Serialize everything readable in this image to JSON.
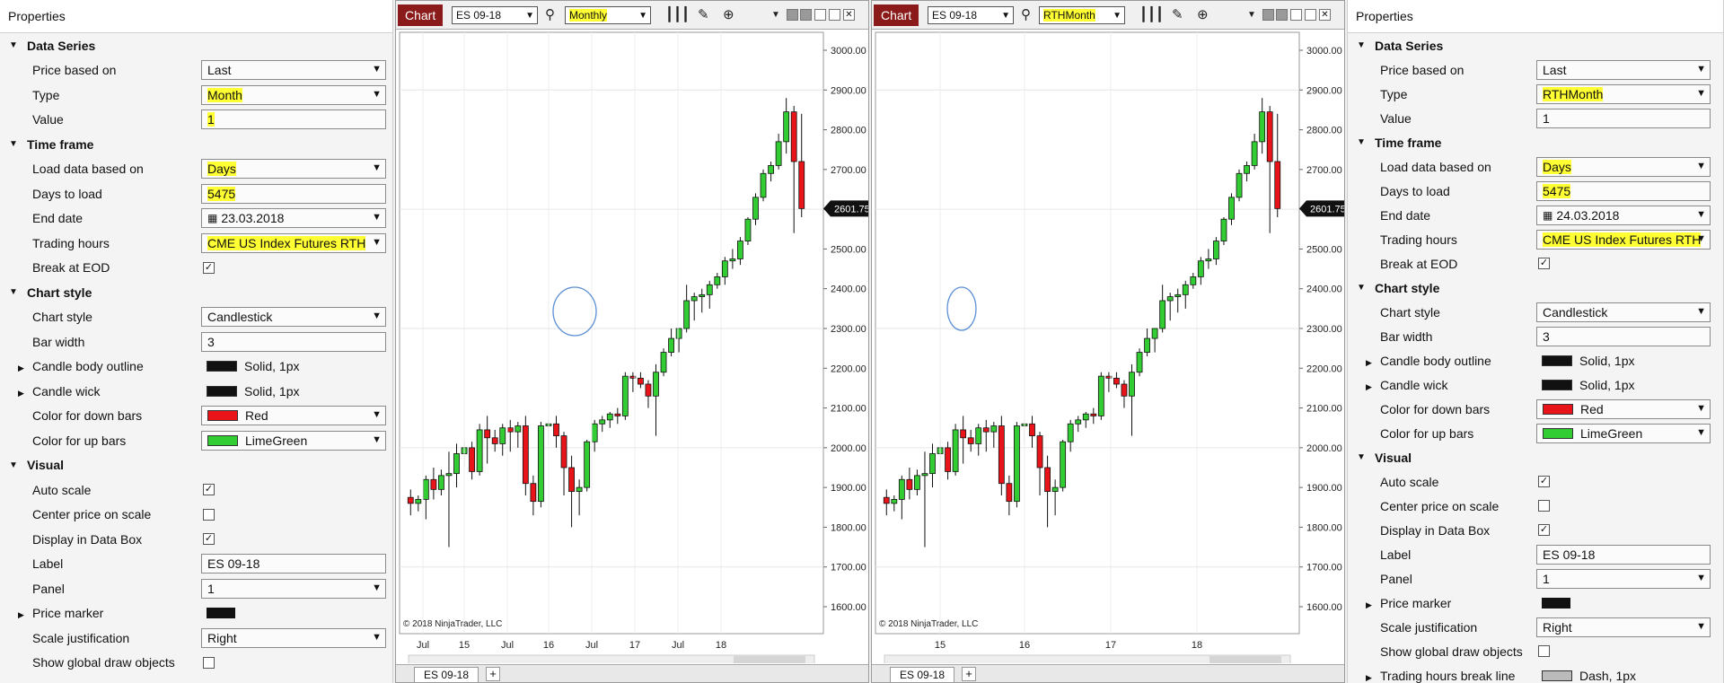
{
  "left_props": {
    "title": "Properties",
    "sections": [
      {
        "name": "Data Series",
        "rows": [
          {
            "label": "Price based on",
            "type": "select",
            "value": "Last"
          },
          {
            "label": "Type",
            "type": "select",
            "value": "Month",
            "hl": true
          },
          {
            "label": "Value",
            "type": "text",
            "value": "1",
            "hl": true
          },
          {
            "label": "",
            "gap": true
          }
        ]
      },
      {
        "name": "Time frame",
        "rows": [
          {
            "label": "Load data based on",
            "type": "select",
            "value": "Days",
            "hl": true
          },
          {
            "label": "Days to load",
            "type": "text",
            "value": "5475",
            "hl": true
          },
          {
            "label": "End date",
            "type": "date",
            "value": "23.03.2018"
          },
          {
            "label": "Trading hours",
            "type": "select",
            "value": "CME US Index Futures RTH",
            "hl": true
          },
          {
            "label": "Break at EOD",
            "type": "check",
            "checked": true
          }
        ]
      },
      {
        "name": "Chart style",
        "rows": [
          {
            "label": "Chart style",
            "type": "select",
            "value": "Candlestick"
          },
          {
            "label": "Bar width",
            "type": "text",
            "value": "3"
          },
          {
            "label": "Candle body outline",
            "type": "stroke",
            "value": "Solid, 1px",
            "expand": true
          },
          {
            "label": "Candle wick",
            "type": "stroke",
            "value": "Solid, 1px",
            "expand": true
          },
          {
            "label": "Color for down bars",
            "type": "color",
            "value": "Red",
            "color": "#e8141a"
          },
          {
            "label": "Color for up bars",
            "type": "color",
            "value": "LimeGreen",
            "color": "#32cd32"
          }
        ]
      },
      {
        "name": "Visual",
        "rows": [
          {
            "label": "Auto scale",
            "type": "check",
            "checked": true
          },
          {
            "label": "Center price on scale",
            "type": "check",
            "checked": false
          },
          {
            "label": "Display in Data Box",
            "type": "check",
            "checked": true
          },
          {
            "label": "Label",
            "type": "text",
            "value": "ES 09-18"
          },
          {
            "label": "Panel",
            "type": "select",
            "value": "1"
          },
          {
            "label": "Price marker",
            "type": "marker",
            "expand": true
          },
          {
            "label": "Scale justification",
            "type": "select",
            "value": "Right"
          },
          {
            "label": "Show global draw objects",
            "type": "check",
            "checked": false
          }
        ]
      }
    ]
  },
  "right_props": {
    "title": "Properties",
    "sections": [
      {
        "name": "Data Series",
        "rows": [
          {
            "label": "Price based on",
            "type": "select",
            "value": "Last"
          },
          {
            "label": "Type",
            "type": "select",
            "value": "RTHMonth",
            "hl": true
          },
          {
            "label": "Value",
            "type": "text",
            "value": "1"
          }
        ]
      },
      {
        "name": "Time frame",
        "rows": [
          {
            "label": "Load data based on",
            "type": "select",
            "value": "Days",
            "hl": true
          },
          {
            "label": "Days to load",
            "type": "text",
            "value": "5475",
            "hl": true
          },
          {
            "label": "End date",
            "type": "date",
            "value": "24.03.2018"
          },
          {
            "label": "Trading hours",
            "type": "select",
            "value": "CME US Index Futures RTH",
            "hl": true
          },
          {
            "label": "Break at EOD",
            "type": "check",
            "checked": true
          }
        ]
      },
      {
        "name": "Chart style",
        "rows": [
          {
            "label": "Chart style",
            "type": "select",
            "value": "Candlestick"
          },
          {
            "label": "Bar width",
            "type": "text",
            "value": "3"
          },
          {
            "label": "Candle body outline",
            "type": "stroke",
            "value": "Solid, 1px",
            "expand": true
          },
          {
            "label": "Candle wick",
            "type": "stroke",
            "value": "Solid, 1px",
            "expand": true
          },
          {
            "label": "Color for down bars",
            "type": "color",
            "value": "Red",
            "color": "#e8141a"
          },
          {
            "label": "Color for up bars",
            "type": "color",
            "value": "LimeGreen",
            "color": "#32cd32"
          }
        ]
      },
      {
        "name": "Visual",
        "rows": [
          {
            "label": "Auto scale",
            "type": "check",
            "checked": true
          },
          {
            "label": "Center price on scale",
            "type": "check",
            "checked": false
          },
          {
            "label": "Display in Data Box",
            "type": "check",
            "checked": true
          },
          {
            "label": "Label",
            "type": "text",
            "value": "ES 09-18"
          },
          {
            "label": "Panel",
            "type": "select",
            "value": "1"
          },
          {
            "label": "Price marker",
            "type": "marker",
            "expand": true
          },
          {
            "label": "Scale justification",
            "type": "select",
            "value": "Right"
          },
          {
            "label": "Show global draw objects",
            "type": "check",
            "checked": false
          },
          {
            "label": "Trading hours break line",
            "type": "stroke2",
            "value": "Dash, 1px",
            "expand": true
          }
        ]
      }
    ]
  },
  "left_chart": {
    "button": "Chart",
    "instrument": "ES 09-18",
    "period": "Monthly",
    "copyright": "© 2018 NinjaTrader, LLC",
    "tab": "ES 09-18",
    "plus": "+",
    "price_label": "2601.75",
    "chart_data": {
      "type": "candlestick",
      "y_ticks": [
        "3000.00",
        "2900.00",
        "2800.00",
        "2700.00",
        "2600.00",
        "2500.00",
        "2400.00",
        "2300.00",
        "2200.00",
        "2100.00",
        "2000.00",
        "1900.00",
        "1800.00",
        "1700.00",
        "1600.00"
      ],
      "ylim": [
        1600,
        3000
      ],
      "x_ticks": [
        "Jul",
        "15",
        "Jul",
        "16",
        "Jul",
        "17",
        "Jul",
        "18"
      ],
      "last": 2601.75
    }
  },
  "right_chart": {
    "button": "Chart",
    "instrument": "ES 09-18",
    "period": "RTHMonth",
    "copyright": "© 2018 NinjaTrader, LLC",
    "tab": "ES 09-18",
    "plus": "+",
    "price_label": "2601.75",
    "chart_data": {
      "type": "candlestick",
      "y_ticks": [
        "3000.00",
        "2900.00",
        "2800.00",
        "2700.00",
        "2600.00",
        "2500.00",
        "2400.00",
        "2300.00",
        "2200.00",
        "2100.00",
        "2000.00",
        "1900.00",
        "1800.00",
        "1700.00",
        "1600.00"
      ],
      "ylim": [
        1600,
        3000
      ],
      "x_ticks": [
        "15",
        "16",
        "17",
        "18"
      ],
      "last": 2601.75
    }
  },
  "candles": [
    [
      1875,
      1895,
      1830,
      1860
    ],
    [
      1860,
      1880,
      1840,
      1870
    ],
    [
      1870,
      1930,
      1820,
      1920
    ],
    [
      1920,
      1950,
      1870,
      1895
    ],
    [
      1895,
      1945,
      1880,
      1930
    ],
    [
      1930,
      1990,
      1750,
      1935
    ],
    [
      1935,
      2010,
      1900,
      1985
    ],
    [
      1985,
      2020,
      1950,
      2000
    ],
    [
      2000,
      2015,
      1920,
      1940
    ],
    [
      1940,
      2060,
      1930,
      2045
    ],
    [
      2045,
      2080,
      1960,
      2025
    ],
    [
      2025,
      2045,
      1990,
      2010
    ],
    [
      2010,
      2060,
      1980,
      2050
    ],
    [
      2050,
      2070,
      1990,
      2040
    ],
    [
      2040,
      2065,
      2000,
      2055
    ],
    [
      2055,
      2080,
      1880,
      1910
    ],
    [
      1910,
      1930,
      1830,
      1865
    ],
    [
      1865,
      2065,
      1850,
      2055
    ],
    [
      2055,
      2070,
      2010,
      2060
    ],
    [
      2060,
      2080,
      2000,
      2030
    ],
    [
      2030,
      2040,
      1880,
      1950
    ],
    [
      1950,
      1980,
      1800,
      1890
    ],
    [
      1890,
      1920,
      1830,
      1900
    ],
    [
      1900,
      2020,
      1890,
      2015
    ],
    [
      2015,
      2070,
      1990,
      2060
    ],
    [
      2060,
      2080,
      2040,
      2070
    ],
    [
      2070,
      2090,
      2050,
      2085
    ],
    [
      2085,
      2100,
      2060,
      2080
    ],
    [
      2080,
      2190,
      2070,
      2180
    ],
    [
      2180,
      2190,
      2140,
      2175
    ],
    [
      2175,
      2190,
      2150,
      2160
    ],
    [
      2160,
      2170,
      2100,
      2130
    ],
    [
      2130,
      2210,
      2030,
      2190
    ],
    [
      2190,
      2250,
      2180,
      2240
    ],
    [
      2240,
      2300,
      2230,
      2275
    ],
    [
      2275,
      2300,
      2240,
      2300
    ],
    [
      2300,
      2410,
      2290,
      2370
    ],
    [
      2370,
      2390,
      2320,
      2380
    ],
    [
      2380,
      2400,
      2340,
      2385
    ],
    [
      2385,
      2420,
      2350,
      2410
    ],
    [
      2410,
      2440,
      2400,
      2430
    ],
    [
      2430,
      2480,
      2410,
      2470
    ],
    [
      2470,
      2500,
      2450,
      2475
    ],
    [
      2475,
      2530,
      2460,
      2520
    ],
    [
      2520,
      2580,
      2510,
      2575
    ],
    [
      2575,
      2640,
      2560,
      2630
    ],
    [
      2630,
      2700,
      2620,
      2690
    ],
    [
      2690,
      2720,
      2670,
      2710
    ],
    [
      2710,
      2790,
      2700,
      2770
    ],
    [
      2770,
      2880,
      2740,
      2845
    ],
    [
      2845,
      2860,
      2540,
      2720
    ],
    [
      2720,
      2840,
      2580,
      2601.75
    ]
  ]
}
